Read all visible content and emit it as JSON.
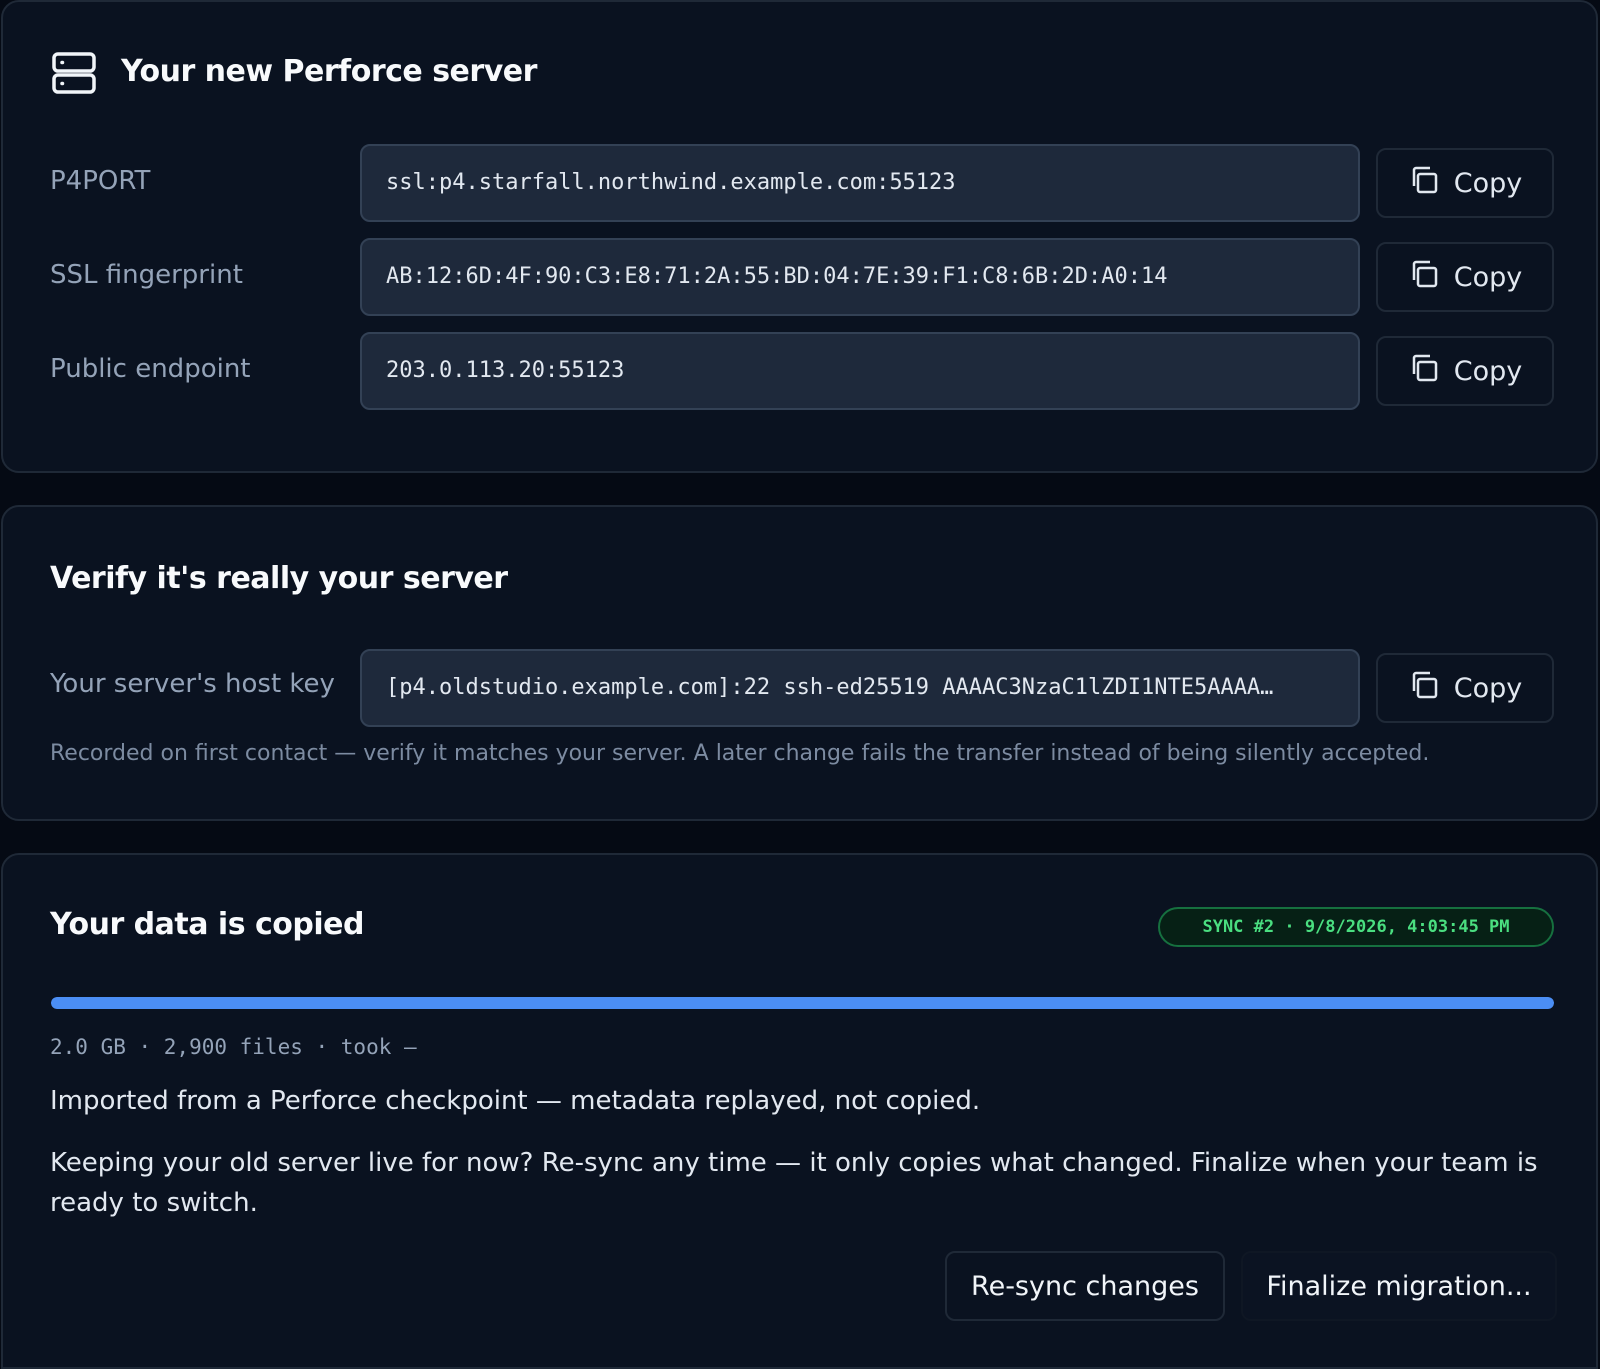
{
  "server_card": {
    "title": "Your new Perforce server",
    "icon": "server-icon",
    "rows": [
      {
        "label": "P4PORT",
        "value": "ssl:p4.starfall.northwind.example.com:55123",
        "copy_label": "Copy"
      },
      {
        "label": "SSL fingerprint",
        "value": "AB:12:6D:4F:90:C3:E8:71:2A:55:BD:04:7E:39:F1:C8:6B:2D:A0:14",
        "copy_label": "Copy"
      },
      {
        "label": "Public endpoint",
        "value": "203.0.113.20:55123",
        "copy_label": "Copy"
      }
    ]
  },
  "verify_card": {
    "title": "Verify it's really your server",
    "host_key_label": "Your server's host key",
    "host_key_value": "[p4.oldstudio.example.com]:22 ssh-ed25519 AAAAC3NzaC1lZDI1NTE5AAAA…",
    "copy_label": "Copy",
    "note": "Recorded on first contact — verify it matches your server. A later change fails the transfer instead of being silently accepted."
  },
  "data_card": {
    "title": "Your data is copied",
    "sync_badge": "SYNC #2 · 9/8/2026, 4:03:45 PM",
    "progress_percent": 100,
    "stats": "2.0 GB · 2,900 files · took —",
    "import_note": "Imported from a Perforce checkpoint — metadata replayed, not copied.",
    "resync_note": "Keeping your old server live for now? Re-sync any time — it only copies what changed. Finalize when your team is ready to switch.",
    "resync_label": "Re-sync changes",
    "finalize_label": "Finalize migration..."
  },
  "colors": {
    "background": "#050a14",
    "card": "#0a1220",
    "field": "#1e293b",
    "accent": "#4b8ef5",
    "success": "#4ade80"
  }
}
